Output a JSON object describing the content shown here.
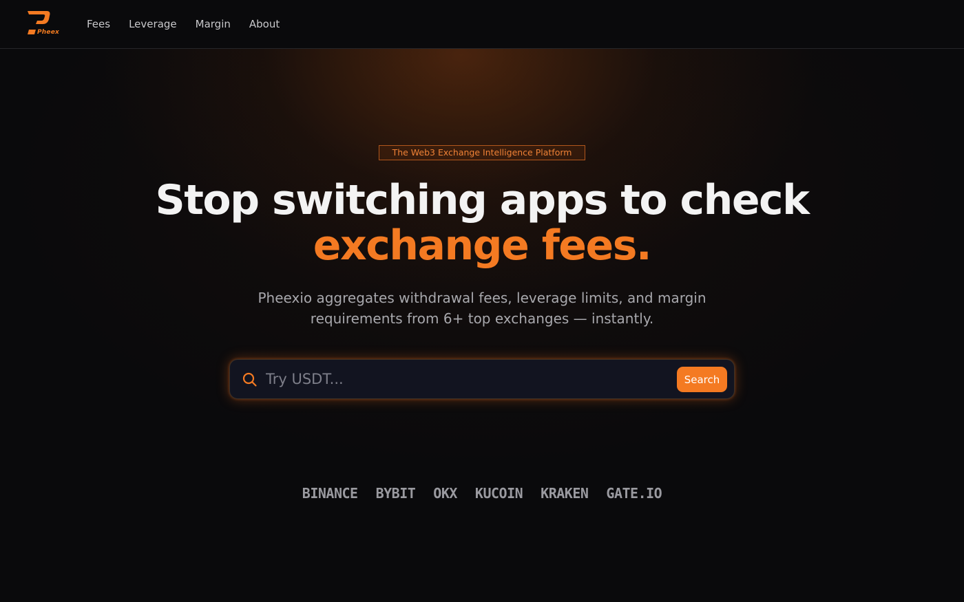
{
  "brand": {
    "logo_text": "Pheex",
    "accent": "#f47a22"
  },
  "nav": {
    "items": [
      "Fees",
      "Leverage",
      "Margin",
      "About"
    ]
  },
  "hero": {
    "badge": "The Web3 Exchange Intelligence Platform",
    "headline_line1": "Stop switching apps to check",
    "headline_line2": "exchange fees.",
    "subtitle_line1": "Pheexio aggregates withdrawal fees, leverage limits, and margin",
    "subtitle_line2": "requirements from 6+ top exchanges — instantly."
  },
  "search": {
    "placeholder": "Try USDT...",
    "value": "",
    "button_label": "Search",
    "icon": "search-icon"
  },
  "exchanges": [
    "BINANCE",
    "BYBIT",
    "OKX",
    "KUCOIN",
    "KRAKEN",
    "GATE.IO"
  ]
}
